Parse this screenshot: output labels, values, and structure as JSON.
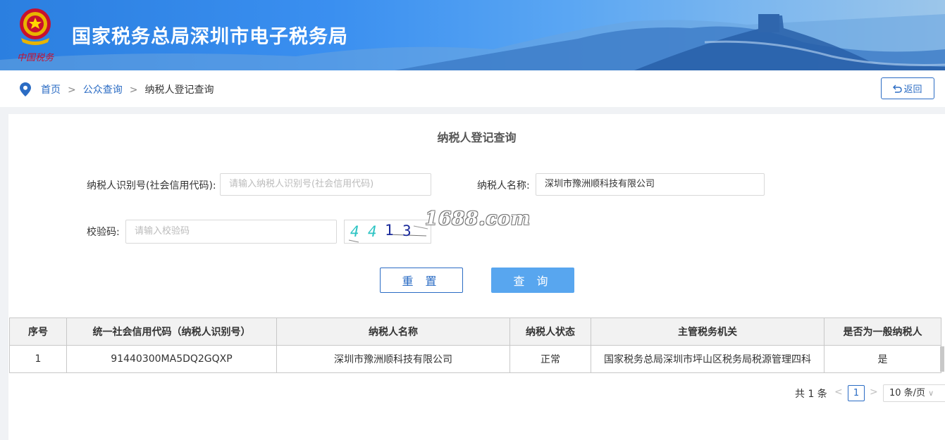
{
  "header": {
    "site_title": "国家税务总局深圳市电子税务局",
    "emblem_caption": "中国税务",
    "colors": {
      "banner_start": "#2b7fe0",
      "banner_end": "#9cc6ea"
    }
  },
  "breadcrumb": {
    "home": "首页",
    "sep1": ">",
    "public_query": "公众查询",
    "sep2": ">",
    "current": "纳税人登记查询",
    "back_label": "返回"
  },
  "form": {
    "title": "纳税人登记查询",
    "taxpayer_id_label": "纳税人识别号(社会信用代码):",
    "taxpayer_id_placeholder": "请输入纳税人识别号(社会信用代码)",
    "taxpayer_id_value": "",
    "taxpayer_name_label": "纳税人名称:",
    "taxpayer_name_value": "深圳市豫洲顺科技有限公司",
    "captcha_label": "校验码:",
    "captcha_placeholder": "请输入校验码",
    "captcha_image_text": "4413",
    "watermark": "1688.com",
    "reset_label": "重 置",
    "query_label": "查 询"
  },
  "table": {
    "headers": [
      "序号",
      "统一社会信用代码（纳税人识别号）",
      "纳税人名称",
      "纳税人状态",
      "主管税务机关",
      "是否为一般纳税人"
    ],
    "rows": [
      [
        "1",
        "91440300MA5DQ2GQXP",
        "深圳市豫洲顺科技有限公司",
        "正常",
        "国家税务总局深圳市坪山区税务局税源管理四科",
        "是"
      ]
    ]
  },
  "pagination": {
    "total": "共 1 条",
    "prev": "<",
    "current_page": "1",
    "next": ">",
    "page_size": "10 条/页"
  },
  "colors": {
    "primary": "#2b6cc4",
    "query_button": "#58a6ef"
  }
}
